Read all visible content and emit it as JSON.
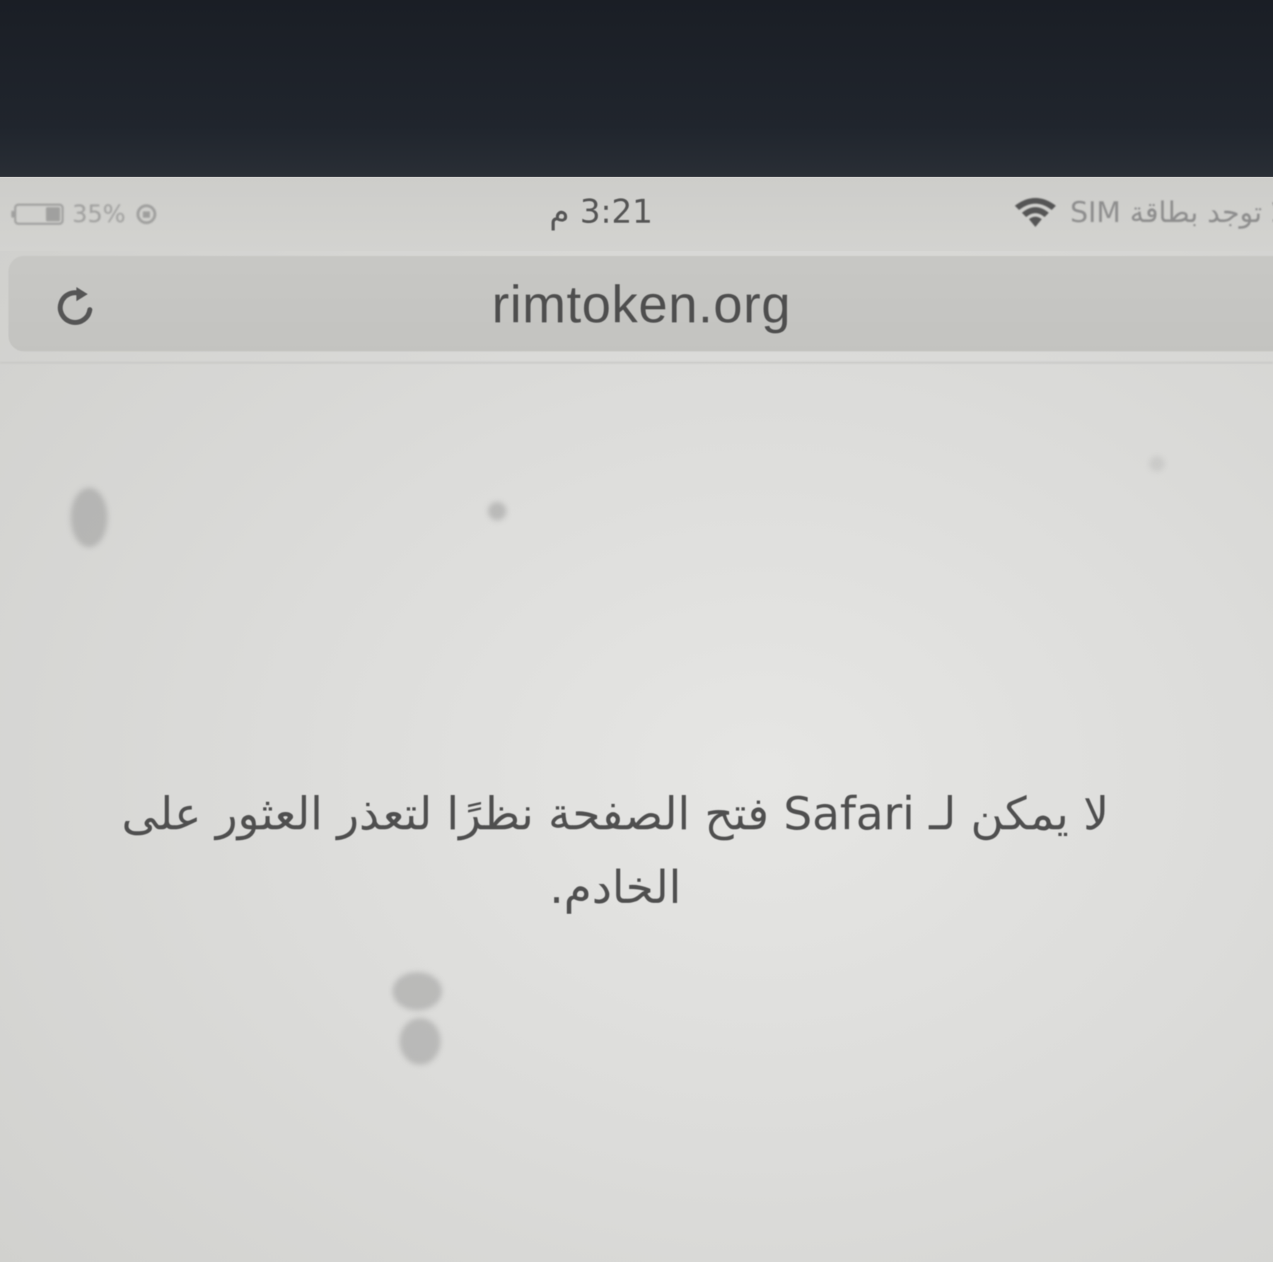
{
  "status_bar": {
    "battery_text": "35%",
    "time": "3:21 م",
    "carrier": "لا توجد بطاقة SIM"
  },
  "url_bar": {
    "url": "rimtoken.org",
    "reload_icon": "reload-icon"
  },
  "error": {
    "message": "لا يمكن لـ Safari فتح الصفحة نظرًا لتعذر العثور على الخادم."
  },
  "icons": [
    "battery-icon",
    "wifi-icon",
    "reload-icon"
  ],
  "colors": {
    "screen_background": "#dcdcda",
    "url_bar_background": "#c5c5c2",
    "text": "#4f4f4f",
    "bezel": "#1c2027"
  }
}
